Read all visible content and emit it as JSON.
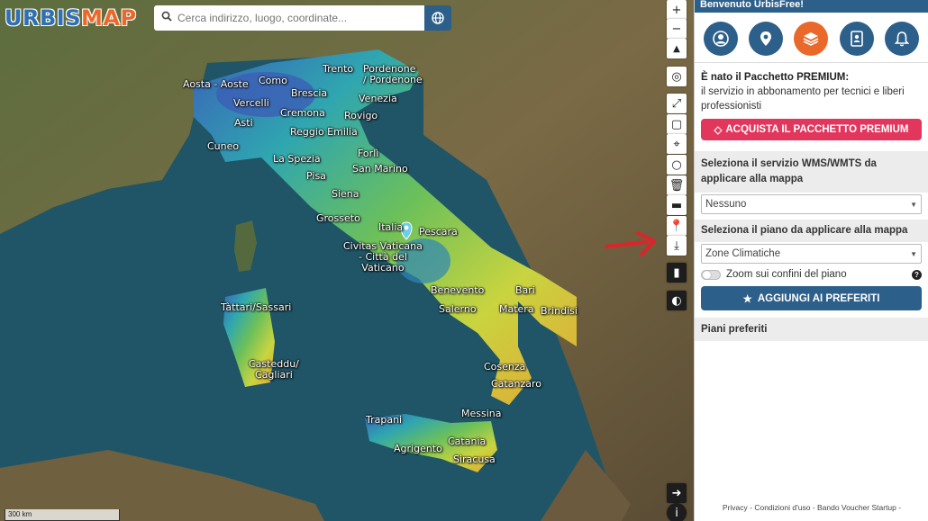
{
  "app": {
    "logo_a": "URBIS",
    "logo_b": "MAP"
  },
  "search": {
    "placeholder": "Cerca indirizzo, luogo, coordinate..."
  },
  "map": {
    "scale": "300 km",
    "cities": [
      {
        "name": "Trento"
      },
      {
        "name": "Pordenone\n/ Pordenone"
      },
      {
        "name": "Aosta - Aoste"
      },
      {
        "name": "Como"
      },
      {
        "name": "Brescia"
      },
      {
        "name": "Venezia"
      },
      {
        "name": "Vercelli"
      },
      {
        "name": "Cremona"
      },
      {
        "name": "Asti"
      },
      {
        "name": "Rovigo"
      },
      {
        "name": "Reggio Emilia"
      },
      {
        "name": "Cuneo"
      },
      {
        "name": "Forlì"
      },
      {
        "name": "La Spezia"
      },
      {
        "name": "San Marino"
      },
      {
        "name": "Pisa"
      },
      {
        "name": "Siena"
      },
      {
        "name": "Grosseto"
      },
      {
        "name": "Italia"
      },
      {
        "name": "Pescara"
      },
      {
        "name": "Civitas Vaticana\n- Città del\nVaticano"
      },
      {
        "name": "Benevento"
      },
      {
        "name": "Bari"
      },
      {
        "name": "Tàttari/Sassari"
      },
      {
        "name": "Salerno"
      },
      {
        "name": "Matera"
      },
      {
        "name": "Brindisi"
      },
      {
        "name": "Casteddu/\nCagliari"
      },
      {
        "name": "Cosenza"
      },
      {
        "name": "Catanzaro"
      },
      {
        "name": "Messina"
      },
      {
        "name": "Trapani"
      },
      {
        "name": "Catania"
      },
      {
        "name": "Agrigento"
      },
      {
        "name": "Siracusa"
      }
    ],
    "colors": {
      "accent": "#2c5f8a",
      "orange": "#e9682a",
      "premium": "#e2365d"
    }
  },
  "toolbar": {
    "zoom_in": "+",
    "zoom_out": "−"
  },
  "panel": {
    "header": "Benvenuto UrbisFree!",
    "icons": [
      "user-icon",
      "pin-icon",
      "layers-icon",
      "contacts-icon",
      "bell-icon"
    ],
    "promo_title": "È nato il Pacchetto PREMIUM:",
    "promo_text": "il servizio in abbonamento per tecnici e liberi professionisti",
    "buy_label": "ACQUISTA IL PACCHETTO PREMIUM",
    "wms_label": "Seleziona il servizio WMS/WMTS da applicare alla mappa",
    "wms_value": "Nessuno",
    "plan_label": "Seleziona il piano da applicare alla mappa",
    "plan_value": "Zone Climatiche",
    "zoom_label": "Zoom sui confini del piano",
    "help": "?",
    "fav_label": "AGGIUNGI AI PREFERITI",
    "fav_header": "Piani preferiti",
    "footer": "Privacy - Condizioni d'uso - Bando Voucher Startup -"
  }
}
